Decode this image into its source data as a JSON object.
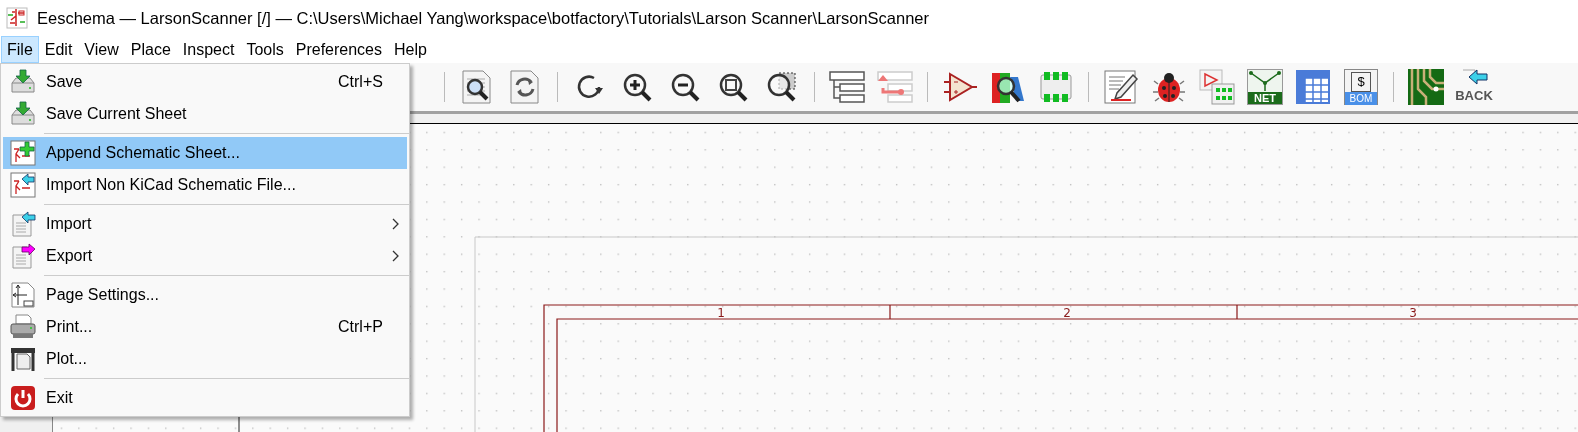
{
  "window": {
    "title": "Eeschema — LarsonScanner [/] — C:\\Users\\Michael Yang\\workspace\\botfactory\\Tutorials\\Larson Scanner\\LarsonScanner"
  },
  "menubar": [
    {
      "label": "File",
      "selected": true
    },
    {
      "label": "Edit",
      "selected": false
    },
    {
      "label": "View",
      "selected": false
    },
    {
      "label": "Place",
      "selected": false
    },
    {
      "label": "Inspect",
      "selected": false
    },
    {
      "label": "Tools",
      "selected": false
    },
    {
      "label": "Preferences",
      "selected": false
    },
    {
      "label": "Help",
      "selected": false
    }
  ],
  "file_menu": [
    {
      "kind": "item",
      "label": "Save",
      "shortcut": "Ctrl+S",
      "selected": false,
      "submenu": false
    },
    {
      "kind": "item",
      "label": "Save Current Sheet",
      "selected": false,
      "submenu": false
    },
    {
      "kind": "separator"
    },
    {
      "kind": "item",
      "label": "Append Schematic Sheet...",
      "selected": true,
      "submenu": false
    },
    {
      "kind": "item",
      "label": "Import Non KiCad Schematic File...",
      "selected": false,
      "submenu": false
    },
    {
      "kind": "separator"
    },
    {
      "kind": "item",
      "label": "Import",
      "selected": false,
      "submenu": true
    },
    {
      "kind": "item",
      "label": "Export",
      "selected": false,
      "submenu": true
    },
    {
      "kind": "separator"
    },
    {
      "kind": "item",
      "label": "Page Settings...",
      "selected": false,
      "submenu": false
    },
    {
      "kind": "item",
      "label": "Print...",
      "shortcut": "Ctrl+P",
      "selected": false,
      "submenu": false
    },
    {
      "kind": "item",
      "label": "Plot...",
      "selected": false,
      "submenu": false
    },
    {
      "kind": "separator"
    },
    {
      "kind": "item",
      "label": "Exit",
      "selected": false,
      "submenu": false
    }
  ],
  "toolbar": {
    "icon_texts": [
      "NET",
      "$",
      "BOM",
      "BACK"
    ]
  },
  "sheet": {
    "columns": [
      "1",
      "2",
      "3"
    ]
  }
}
